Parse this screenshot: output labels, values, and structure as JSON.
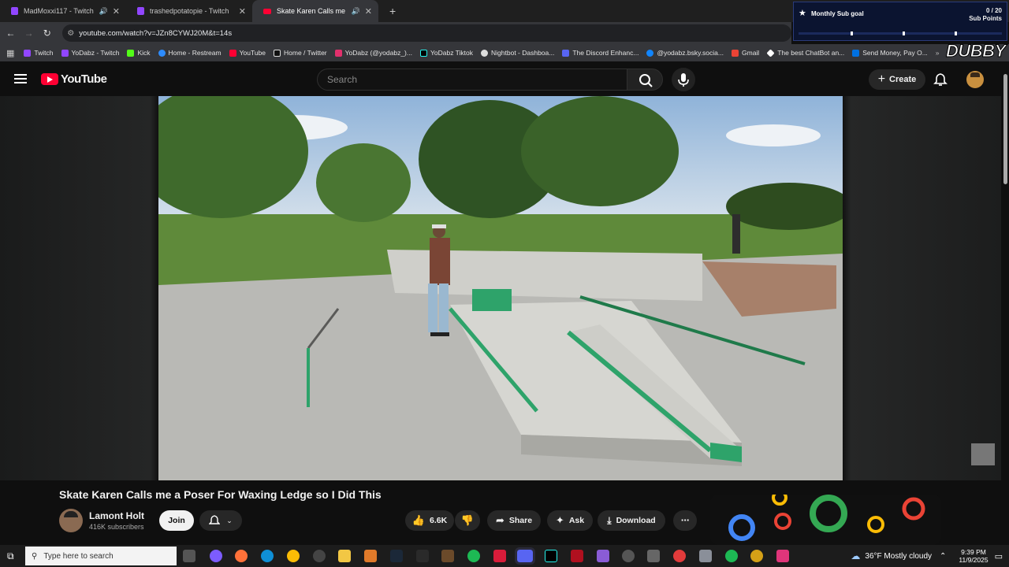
{
  "browser": {
    "tabs": [
      {
        "label": "MadMoxxi117 - Twitch",
        "icon": "twitch-icon",
        "audio": true
      },
      {
        "label": "trashedpotatopie - Twitch",
        "icon": "twitch-icon",
        "audio": false
      },
      {
        "label": "Skate Karen Calls me a Pose",
        "icon": "youtube-icon",
        "audio": true
      }
    ],
    "url": "youtube.com/watch?v=JZn8CYWJ20M&t=14s",
    "bookmarks": [
      {
        "label": "Twitch",
        "icon": "twitch-icon",
        "color": "#9146ff"
      },
      {
        "label": "YoDabz - Twitch",
        "icon": "twitch-icon",
        "color": "#9146ff"
      },
      {
        "label": "Kick",
        "icon": "kick-icon",
        "color": "#53fc18"
      },
      {
        "label": "Home - Restream",
        "icon": "restream-icon",
        "color": "#2d8cff"
      },
      {
        "label": "YouTube",
        "icon": "youtube-icon",
        "color": "#ff0033"
      },
      {
        "label": "Home / Twitter",
        "icon": "x-icon",
        "color": "#ffffff"
      },
      {
        "label": "YoDabz (@yodabz_)...",
        "icon": "instagram-icon",
        "color": "#e1306c"
      },
      {
        "label": "YoDabz Tiktok",
        "icon": "tiktok-icon",
        "color": "#ffffff"
      },
      {
        "label": "Nightbot - Dashboa...",
        "icon": "nightbot-icon",
        "color": "#dddddd"
      },
      {
        "label": "The Discord Enhanc...",
        "icon": "discord-icon",
        "color": "#5865f2"
      },
      {
        "label": "@yodabz.bsky.socia...",
        "icon": "bluesky-icon",
        "color": "#1185fe"
      },
      {
        "label": "Gmail",
        "icon": "gmail-icon",
        "color": "#ea4335"
      },
      {
        "label": "The best ChatBot an...",
        "icon": "chatbot-icon",
        "color": "#ffffff"
      },
      {
        "label": "Send Money, Pay O...",
        "icon": "paypal-icon",
        "color": "#0070e0"
      }
    ]
  },
  "overlay": {
    "sub_goal_title": "Monthly Sub goal",
    "sub_goal_value": "0 / 20",
    "sub_goal_unit": "Sub Points",
    "brand": "DUBBY"
  },
  "youtube": {
    "logo": "YouTube",
    "search_placeholder": "Search",
    "create_label": "Create",
    "video_title": "Skate Karen Calls me a Poser For Waxing Ledge so I Did This",
    "channel_name": "Lamont Holt",
    "subscribers": "416K subscribers",
    "join_label": "Join",
    "likes": "6.6K",
    "share_label": "Share",
    "ask_label": "Ask",
    "download_label": "Download"
  },
  "taskbar": {
    "search_placeholder": "Type here to search",
    "weather": "36°F  Mostly cloudy",
    "time": "9:39 PM",
    "date": "11/9/2025"
  }
}
